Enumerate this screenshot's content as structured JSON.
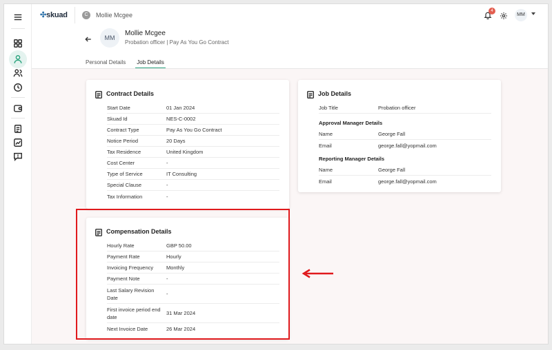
{
  "app": {
    "logo_text": "skuad",
    "top_user_initial": "C",
    "top_user_name": "Mollie Mcgee",
    "notification_count": "4",
    "user_initials": "MM"
  },
  "employee": {
    "initials": "MM",
    "name": "Mollie Mcgee",
    "role_line": "Probation officer | Pay As You Go Contract"
  },
  "tabs": [
    {
      "label": "Personal Details",
      "active": false
    },
    {
      "label": "Job Details",
      "active": true
    }
  ],
  "contract": {
    "title": "Contract Details",
    "rows": [
      {
        "k": "Start Date",
        "v": "01 Jan 2024"
      },
      {
        "k": "Skuad Id",
        "v": "NES-C-0002"
      },
      {
        "k": "Contract Type",
        "v": "Pay As You Go Contract"
      },
      {
        "k": "Notice Period",
        "v": "20 Days"
      },
      {
        "k": "Tax Residence",
        "v": "United Kingdom"
      },
      {
        "k": "Cost Center",
        "v": "-"
      },
      {
        "k": "Type of Service",
        "v": "IT Consulting"
      },
      {
        "k": "Special Clause",
        "v": "-"
      },
      {
        "k": "Tax Information",
        "v": "-"
      }
    ]
  },
  "job": {
    "title": "Job Details",
    "job_title_label": "Job Title",
    "job_title_value": "Probation officer",
    "approval_heading": "Approval Manager Details",
    "approval_rows": [
      {
        "k": "Name",
        "v": "George Fall"
      },
      {
        "k": "Email",
        "v": "george.fall@yopmail.com"
      }
    ],
    "reporting_heading": "Reporting Manager Details",
    "reporting_rows": [
      {
        "k": "Name",
        "v": "George Fall"
      },
      {
        "k": "Email",
        "v": "george.fall@yopmail.com"
      }
    ]
  },
  "compensation": {
    "title": "Compensation Details",
    "rows": [
      {
        "k": "Hourly Rate",
        "v": "GBP 50.00"
      },
      {
        "k": "Payment Rate",
        "v": "Hourly"
      },
      {
        "k": "Invoicing Frequency",
        "v": "Monthly"
      },
      {
        "k": "Payment Note",
        "v": "-"
      },
      {
        "k": "Last Salary Revision Date",
        "v": "-"
      },
      {
        "k": "First invoice period end date",
        "v": "31 Mar 2024"
      },
      {
        "k": "Next Invoice Date",
        "v": "26 Mar 2024"
      }
    ]
  },
  "colors": {
    "accent": "#2aa37d",
    "highlight": "#e0191c",
    "badge": "#e35d4f"
  }
}
